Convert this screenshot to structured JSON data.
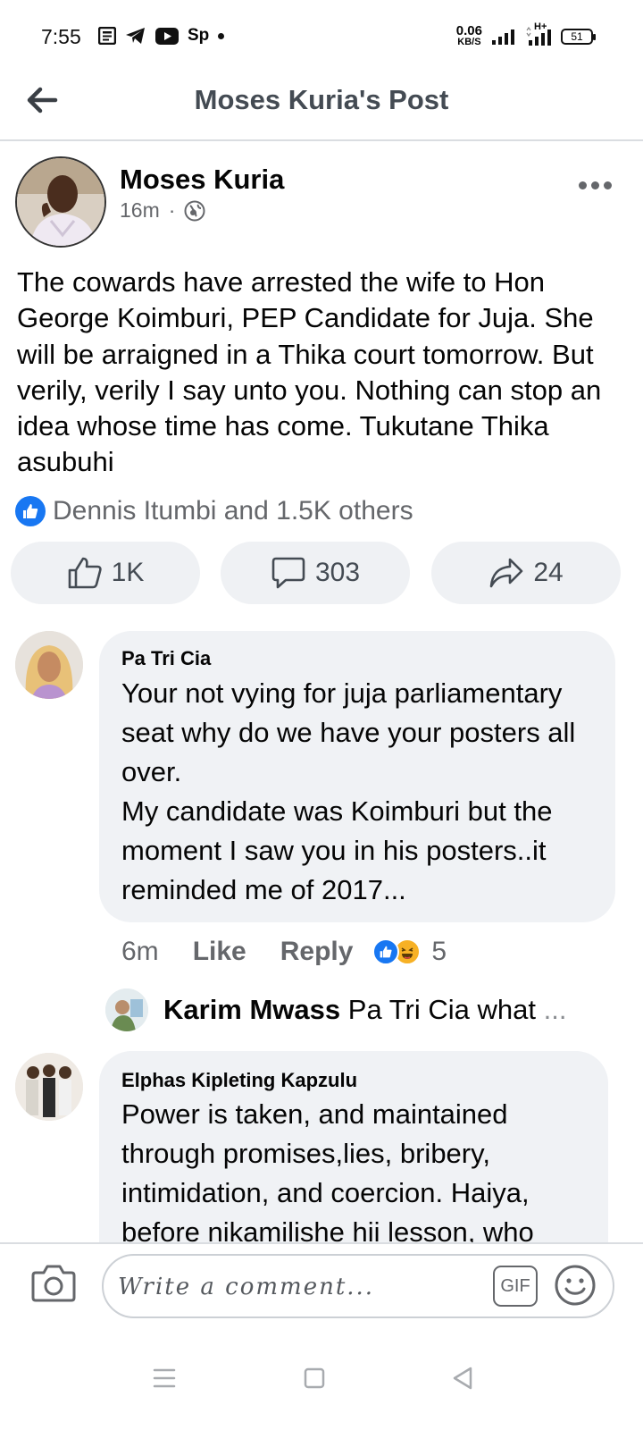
{
  "status_bar": {
    "time": "7:55",
    "app_label": "Sp",
    "speed_value": "0.06",
    "speed_unit": "KB/S",
    "network": "H+",
    "battery": "51"
  },
  "header": {
    "title": "Moses Kuria's Post"
  },
  "post": {
    "author": "Moses Kuria",
    "time": "16m",
    "separator": "·",
    "text": "The cowards have arrested the wife to Hon George Koimburi, PEP Candidate for Juja. She will be arraigned in a Thika court tomorrow. But verily, verily I say unto you. Nothing can stop an idea whose time has come. Tukutane Thika asubuhi",
    "reactions_summary": "Dennis Itumbi and 1.5K others",
    "actions": {
      "likes": "1K",
      "comments": "303",
      "shares": "24"
    }
  },
  "comments": [
    {
      "name": "Pa Tri Cia",
      "text": "Your not vying for juja parliamentary seat why do we have your posters all over.\nMy candidate was Koimburi  but the moment I saw you in his posters..it reminded me of 2017...",
      "time": "6m",
      "like_label": "Like",
      "reply_label": "Reply",
      "reaction_count": "5",
      "reply_preview": {
        "name": "Karim Mwass",
        "text": "Pa Tri Cia what",
        "ellipsis": "..."
      }
    },
    {
      "name": "Elphas Kipleting Kapzulu",
      "text": "Power is taken, and maintained through promises,lies, bribery, intimidation, and coercion. Haiya, before nikamilishe hii lesson, who"
    }
  ],
  "composer": {
    "placeholder": "Write a comment...",
    "gif_label": "GIF"
  },
  "colors": {
    "facebook_blue": "#1877f2",
    "secondary_text": "#65676b",
    "bubble_bg": "#f0f2f5",
    "action_bg": "#eff1f4"
  }
}
